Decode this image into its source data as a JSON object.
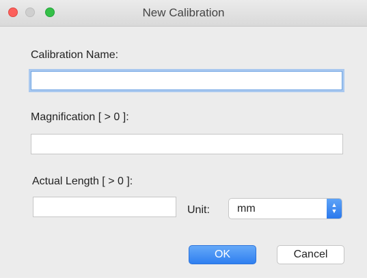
{
  "window": {
    "title": "New Calibration"
  },
  "form": {
    "calibration_name": {
      "label": "Calibration Name:",
      "value": ""
    },
    "magnification": {
      "label": "Magnification [ > 0 ]:",
      "value": ""
    },
    "actual_length": {
      "label": "Actual Length [ > 0 ]:",
      "value": ""
    },
    "unit": {
      "label": "Unit:",
      "selected": "mm"
    }
  },
  "buttons": {
    "ok": "OK",
    "cancel": "Cancel"
  },
  "colors": {
    "accent": "#2f7ff0",
    "focus_ring": "#a9c8ef",
    "close": "#fc605c",
    "zoom": "#35c048"
  },
  "icons": {
    "close": "close-traffic-light-icon",
    "minimize": "minimize-traffic-light-icon",
    "zoom": "zoom-traffic-light-icon",
    "select_arrows": "up-down-chevron-icon"
  }
}
